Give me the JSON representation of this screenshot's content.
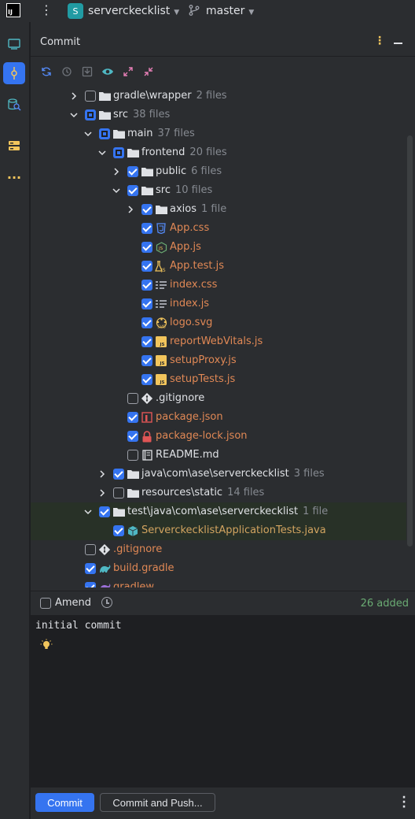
{
  "titlebar": {
    "logo_text": "IJ",
    "project_initial": "S",
    "project_name": "serverckecklist",
    "branch": "master"
  },
  "sidebar": {
    "items": [
      {
        "name": "project-icon"
      },
      {
        "name": "commit-icon",
        "active": true
      },
      {
        "name": "database-icon"
      },
      {
        "name": "structure-icon"
      },
      {
        "name": "more-icon"
      }
    ]
  },
  "panel": {
    "title": "Commit"
  },
  "tree": {
    "rows": [
      {
        "label": "gradle\\wrapper",
        "count": "2 files"
      },
      {
        "label": "src",
        "count": "38 files"
      },
      {
        "label": "main",
        "count": "37 files"
      },
      {
        "label": "frontend",
        "count": "20 files"
      },
      {
        "label": "public",
        "count": "6 files"
      },
      {
        "label": "src",
        "count": "10 files"
      },
      {
        "label": "axios",
        "count": "1 file"
      },
      {
        "label": "App.css"
      },
      {
        "label": "App.js"
      },
      {
        "label": "App.test.js"
      },
      {
        "label": "index.css"
      },
      {
        "label": "index.js"
      },
      {
        "label": "logo.svg"
      },
      {
        "label": "reportWebVitals.js"
      },
      {
        "label": "setupProxy.js"
      },
      {
        "label": "setupTests.js"
      },
      {
        "label": ".gitignore"
      },
      {
        "label": "package.json"
      },
      {
        "label": "package-lock.json"
      },
      {
        "label": "README.md"
      },
      {
        "label": "java\\com\\ase\\serverckecklist",
        "count": "3 files"
      },
      {
        "label": "resources\\static",
        "count": "14 files"
      },
      {
        "label": "test\\java\\com\\ase\\serverckecklist",
        "count": "1 file"
      },
      {
        "label": "ServerckecklistApplicationTests.java"
      },
      {
        "label": ".gitignore"
      },
      {
        "label": "build.gradle"
      },
      {
        "label": "gradlew"
      }
    ]
  },
  "amend": {
    "label": "Amend",
    "added": "26 added"
  },
  "message": {
    "text": "initial commit"
  },
  "buttons": {
    "commit": "Commit",
    "commit_push": "Commit and Push..."
  },
  "colors": {
    "accent": "#3574f0",
    "added_green": "#6aab73",
    "modified_orange": "#e08855"
  }
}
